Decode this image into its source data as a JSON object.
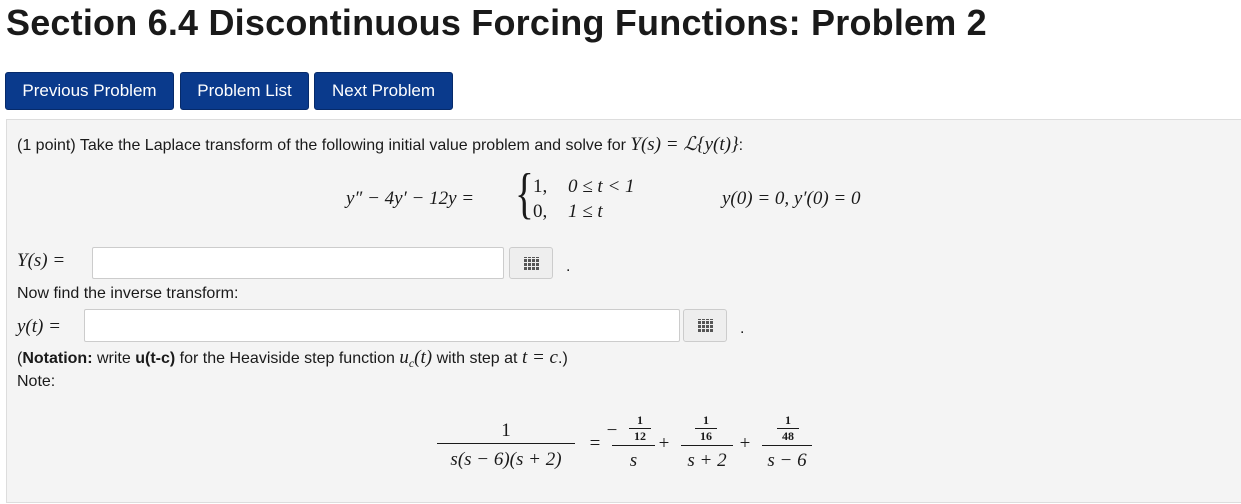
{
  "page": {
    "title": "Section 6.4 Discontinuous Forcing Functions: Problem 2"
  },
  "nav": {
    "previous": "Previous Problem",
    "list": "Problem List",
    "next": "Next Problem"
  },
  "problem": {
    "points": "(1 point)",
    "intro": "Take the Laplace transform of the following initial value problem and solve for",
    "intro_math": "Y(s) = ℒ{y(t)}",
    "intro_end": ":",
    "ode_lhs": "y″ − 4y′ − 12y =",
    "case1_value": "1,",
    "case1_cond": "0 ≤ t < 1",
    "case2_value": "0,",
    "case2_cond": "1 ≤ t",
    "initial_conditions": "y(0) = 0,  y′(0) = 0",
    "ys_label": "Y(s) =",
    "ys_value": "",
    "ys_period": ".",
    "inverse_prompt": "Now find the inverse transform:",
    "yt_label": "y(t) =",
    "yt_value": "",
    "yt_period": ".",
    "notation_open": "(",
    "notation_bold": "Notation:",
    "notation_write": "write",
    "notation_code": "u(t-c)",
    "notation_text": "for the Heaviside step function",
    "notation_math": "u",
    "notation_sub": "c",
    "notation_math2": "(t)",
    "notation_text2": "with step at",
    "notation_math3": "t = c",
    "notation_close": ".)",
    "note_label": "Note:",
    "note": {
      "lhs_num": "1",
      "lhs_den": "s(s − 6)(s + 2)",
      "eq": "=",
      "t1_sign": "−",
      "t1_num": "1",
      "t1_den": "12",
      "t1_var": "s",
      "plus1": "+",
      "t2_num": "1",
      "t2_den": "16",
      "t2_var": "s + 2",
      "plus2": "+",
      "t3_num": "1",
      "t3_den": "48",
      "t3_var": "s − 6"
    }
  },
  "colors": {
    "button_bg": "#0a3a8c",
    "panel_bg": "#f4f4f4"
  }
}
